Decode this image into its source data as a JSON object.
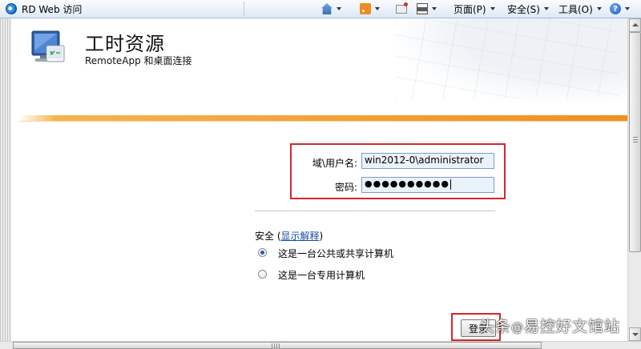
{
  "browser": {
    "tab_title": "RD Web 访问",
    "commands": {
      "page_menu": "页面(P)",
      "safety_menu": "安全(S)",
      "tools_menu": "工具(O)"
    },
    "icons": [
      "home-icon",
      "rss-feed-icon",
      "read-mail-icon",
      "print-icon",
      "help-icon"
    ]
  },
  "app": {
    "title": "工时资源",
    "subtitle": "RemoteApp 和桌面连接"
  },
  "form": {
    "username_label": "域\\用户名:",
    "username_value": "win2012-0\\administrator",
    "password_label": "密码:",
    "password_masked": "●●●●●●●●●●",
    "security_label": "安全 (",
    "security_link": "显示解释",
    "security_close": ")",
    "options": [
      {
        "label": "这是一台公共或共享计算机",
        "selected": true
      },
      {
        "label": "这是一台专用计算机",
        "selected": false
      }
    ],
    "login_button": "登录"
  },
  "watermark": {
    "prefix": "头条",
    "at": "@",
    "name": "易控好文馆站"
  },
  "colors": {
    "highlight_box": "#d4262d",
    "accent_orange": "#f3a23a",
    "link": "#1a4fa8"
  }
}
